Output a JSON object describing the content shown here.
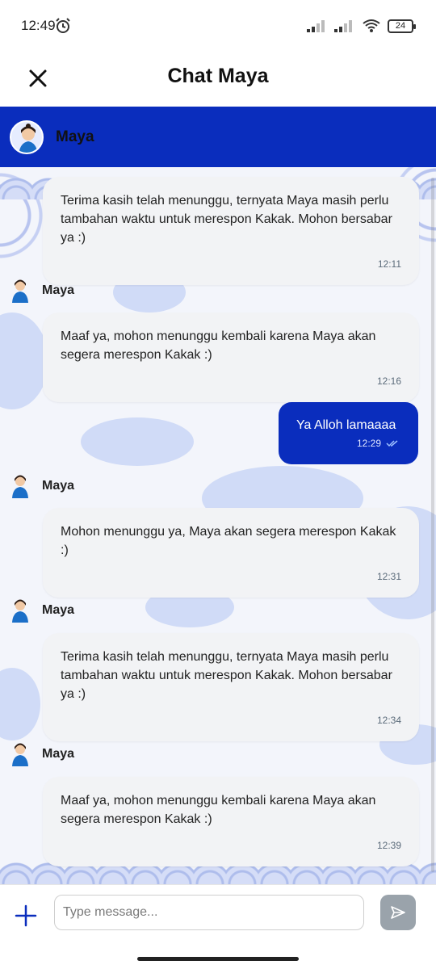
{
  "status_bar": {
    "time": "12:49",
    "battery": "24"
  },
  "header": {
    "title": "Chat Maya"
  },
  "agent": {
    "name": "Maya"
  },
  "messages": [
    {
      "type": "bot",
      "show_sender": false,
      "sender": "Maya",
      "text": "Terima kasih telah menunggu, ternyata Maya masih perlu tambahan waktu untuk merespon Kakak. Mohon bersabar ya :)",
      "time": "12:11"
    },
    {
      "type": "bot",
      "show_sender": true,
      "sender": "Maya",
      "text": "Maaf ya, mohon menunggu kembali karena Maya akan segera merespon Kakak :)",
      "time": "12:16"
    },
    {
      "type": "user",
      "text": "Ya Alloh lamaaaa",
      "time": "12:29",
      "status": "read"
    },
    {
      "type": "bot",
      "show_sender": true,
      "sender": "Maya",
      "text": "Mohon menunggu ya, Maya akan segera merespon Kakak :)",
      "time": "12:31"
    },
    {
      "type": "bot",
      "show_sender": true,
      "sender": "Maya",
      "text": "Terima kasih telah menunggu, ternyata Maya masih perlu tambahan waktu untuk merespon Kakak. Mohon bersabar ya :)",
      "time": "12:34"
    },
    {
      "type": "bot",
      "show_sender": true,
      "sender": "Maya",
      "text": "Maaf ya, mohon menunggu kembali karena Maya akan segera merespon Kakak :)",
      "time": "12:39"
    }
  ],
  "composer": {
    "placeholder": "Type message...",
    "value": ""
  },
  "icons": {
    "close": "close-icon",
    "alarm": "alarm-icon",
    "plus": "plus-icon",
    "send": "send-icon",
    "read": "double-check-icon"
  },
  "colors": {
    "brand": "#0a2dbd",
    "bubble": "#f2f3f5",
    "send_disabled": "#9aa3ab"
  }
}
